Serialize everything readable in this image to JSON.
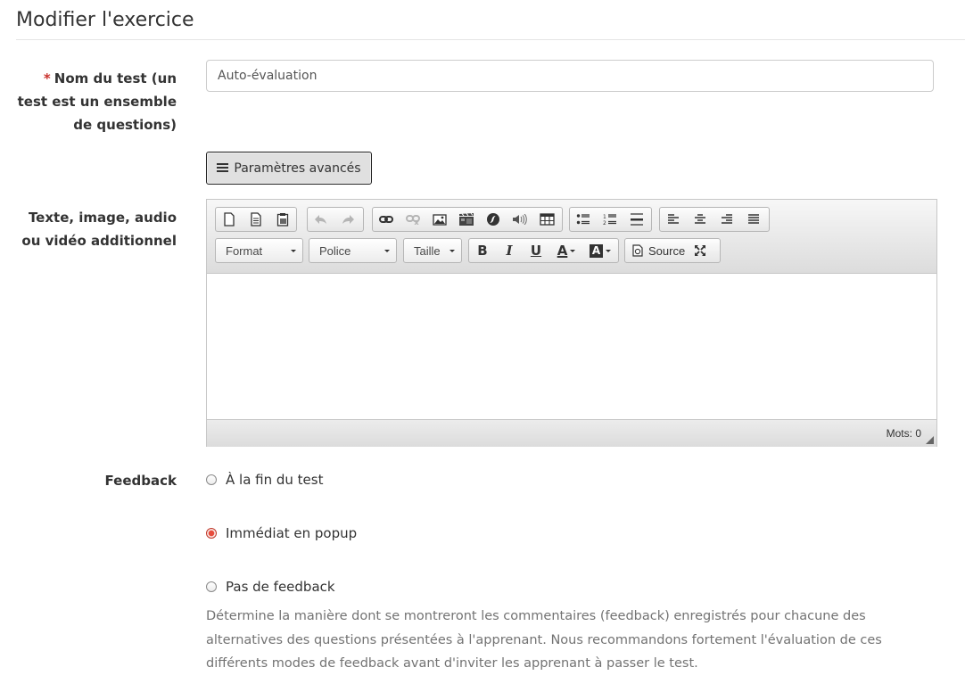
{
  "page": {
    "title": "Modifier l'exercice"
  },
  "test_name": {
    "required_marker": "*",
    "label": "Nom du test (un test est un ensemble de questions)",
    "value": "Auto-évaluation"
  },
  "advanced_button": {
    "label": "Paramètres avancés",
    "icon": "hamburger-icon"
  },
  "additional_content": {
    "label": "Texte, image, audio ou vidéo additionnel",
    "toolbar": {
      "row1_icons": [
        "new-page-icon",
        "templates-icon",
        "paste-from-word-icon",
        "undo-icon",
        "redo-icon",
        "link-icon",
        "unlink-icon",
        "image-icon",
        "video-icon",
        "flash-icon",
        "audio-icon",
        "table-icon",
        "bulleted-list-icon",
        "numbered-list-icon",
        "horizontal-rule-icon",
        "align-left-icon",
        "align-center-icon",
        "align-right-icon",
        "justify-icon"
      ],
      "format_label": "Format",
      "font_label": "Police",
      "size_label": "Taille",
      "bold": "B",
      "italic": "I",
      "underline": "U",
      "text_color": "A",
      "bg_color": "A",
      "source_label": "Source"
    },
    "word_count": "Mots: 0"
  },
  "feedback": {
    "label": "Feedback",
    "options": [
      {
        "label": "À la fin du test",
        "checked": false
      },
      {
        "label": "Immédiat en popup",
        "checked": true
      },
      {
        "label": "Pas de feedback",
        "checked": false
      }
    ],
    "help": "Détermine la manière dont se montreront les commentaires (feedback) enregistrés pour chacune des alternatives des questions présentées à l'apprenant. Nous recommandons fortement l'évaluation de ces différents modes de feedback avant d'inviter les apprenant à passer le test."
  },
  "colors": {
    "required": "#c9302c",
    "radio_checked": "#e74c3c"
  }
}
